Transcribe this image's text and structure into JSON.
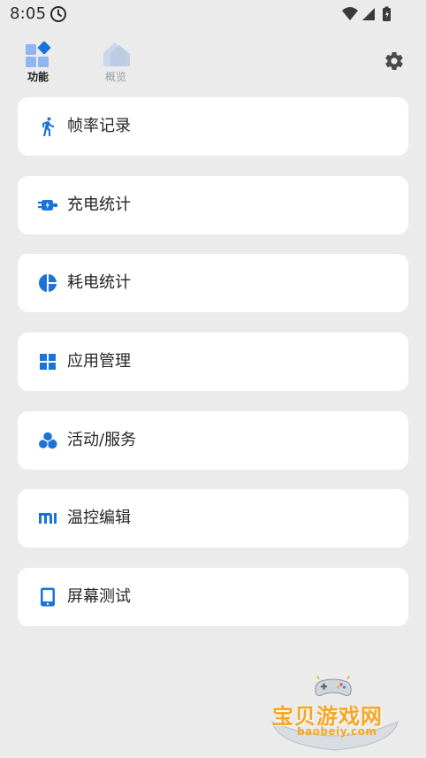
{
  "status_bar": {
    "time": "8:05"
  },
  "tabs": [
    {
      "label": "功能",
      "active": true,
      "icon": "grid-diamond-icon"
    },
    {
      "label": "概览",
      "active": false,
      "icon": "house-icon"
    }
  ],
  "settings": {
    "icon": "gear-icon"
  },
  "menu": {
    "items": [
      {
        "label": "帧率记录",
        "icon": "running-person-icon"
      },
      {
        "label": "充电统计",
        "icon": "charger-plug-icon"
      },
      {
        "label": "耗电统计",
        "icon": "pie-chart-icon"
      },
      {
        "label": "应用管理",
        "icon": "four-squares-icon"
      },
      {
        "label": "活动/服务",
        "icon": "three-circles-icon"
      },
      {
        "label": "温控编辑",
        "icon": "mi-logo-icon"
      },
      {
        "label": "屏幕测试",
        "icon": "tablet-screen-icon"
      }
    ]
  },
  "watermark": {
    "title": "宝贝游戏网",
    "url": "baobeiy.com"
  },
  "colors": {
    "accent": "#1a73d9",
    "background": "#ebebeb",
    "card": "#ffffff",
    "watermark": "#f5a623"
  }
}
